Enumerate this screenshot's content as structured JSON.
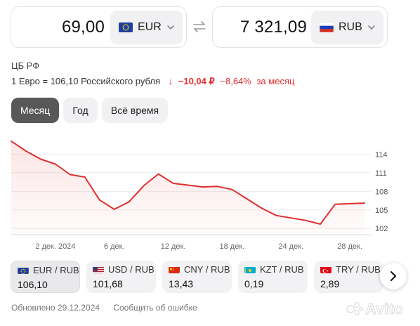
{
  "converter": {
    "from_amount": "69,00",
    "from_currency": "EUR",
    "to_amount": "7 321,09",
    "to_currency": "RUB"
  },
  "source": "ЦБ РФ",
  "rate": {
    "text": "1 Евро = 106,10 Российского рубля",
    "arrow": "↓",
    "change_abs": "−10,04 ₽",
    "change_pct": "−8,64%",
    "period_text": "за месяц"
  },
  "periods": [
    "Месяц",
    "Год",
    "Всё время"
  ],
  "active_period": "Месяц",
  "chart_data": {
    "type": "area",
    "x": [
      "29 нояб.",
      "30 нояб.",
      "1 дек.",
      "2 дек.",
      "3 дек.",
      "4 дек.",
      "5 дек.",
      "6 дек.",
      "7 дек.",
      "10 дек.",
      "11 дек.",
      "12 дек.",
      "13 дек.",
      "14 дек.",
      "17 дек.",
      "18 дек.",
      "19 дек.",
      "20 дек.",
      "21 дек.",
      "24 дек.",
      "25 дек.",
      "26 дек.",
      "27 дек.",
      "28 дек.",
      "29 дек."
    ],
    "y": [
      116.1,
      114.5,
      113.2,
      112.4,
      110.7,
      110.3,
      106.6,
      105.1,
      106.3,
      108.9,
      110.8,
      109.3,
      109.0,
      108.7,
      108.8,
      108.3,
      106.8,
      105.3,
      104.1,
      103.7,
      103.3,
      102.7,
      105.9,
      106.0,
      106.1
    ],
    "y_ticks": [
      "114",
      "111",
      "108",
      "105",
      "102"
    ],
    "x_ticks": [
      "2 дек. 2024",
      "6 дек.",
      "12 дек.",
      "18 дек.",
      "24 дек.",
      "28 дек."
    ],
    "ylim": [
      101,
      117
    ],
    "grid": true,
    "color": "#e02f2f"
  },
  "pairs": [
    {
      "name": "EUR / RUB",
      "value": "106,10",
      "flag": "eu"
    },
    {
      "name": "USD / RUB",
      "value": "101,68",
      "flag": "us"
    },
    {
      "name": "CNY / RUB",
      "value": "13,43",
      "flag": "cn"
    },
    {
      "name": "KZT / RUB",
      "value": "0,19",
      "flag": "kz"
    },
    {
      "name": "TRY / RUB",
      "value": "2,89",
      "flag": "tr"
    }
  ],
  "footer": {
    "updated": "Обновлено 29.12.2024",
    "report": "Сообщить об ошибке"
  },
  "watermark": "Avito",
  "colors": {
    "accent_red": "#e02f2f",
    "active_tab": "#585858",
    "chip_bg": "#f1f1f3"
  },
  "icons": [
    "eu-flag-icon",
    "ru-flag-icon",
    "swap-icon",
    "chevron-down-icon",
    "arrow-down-icon",
    "chevron-right-icon",
    "us-flag-icon",
    "cn-flag-icon",
    "kz-flag-icon",
    "tr-flag-icon"
  ]
}
